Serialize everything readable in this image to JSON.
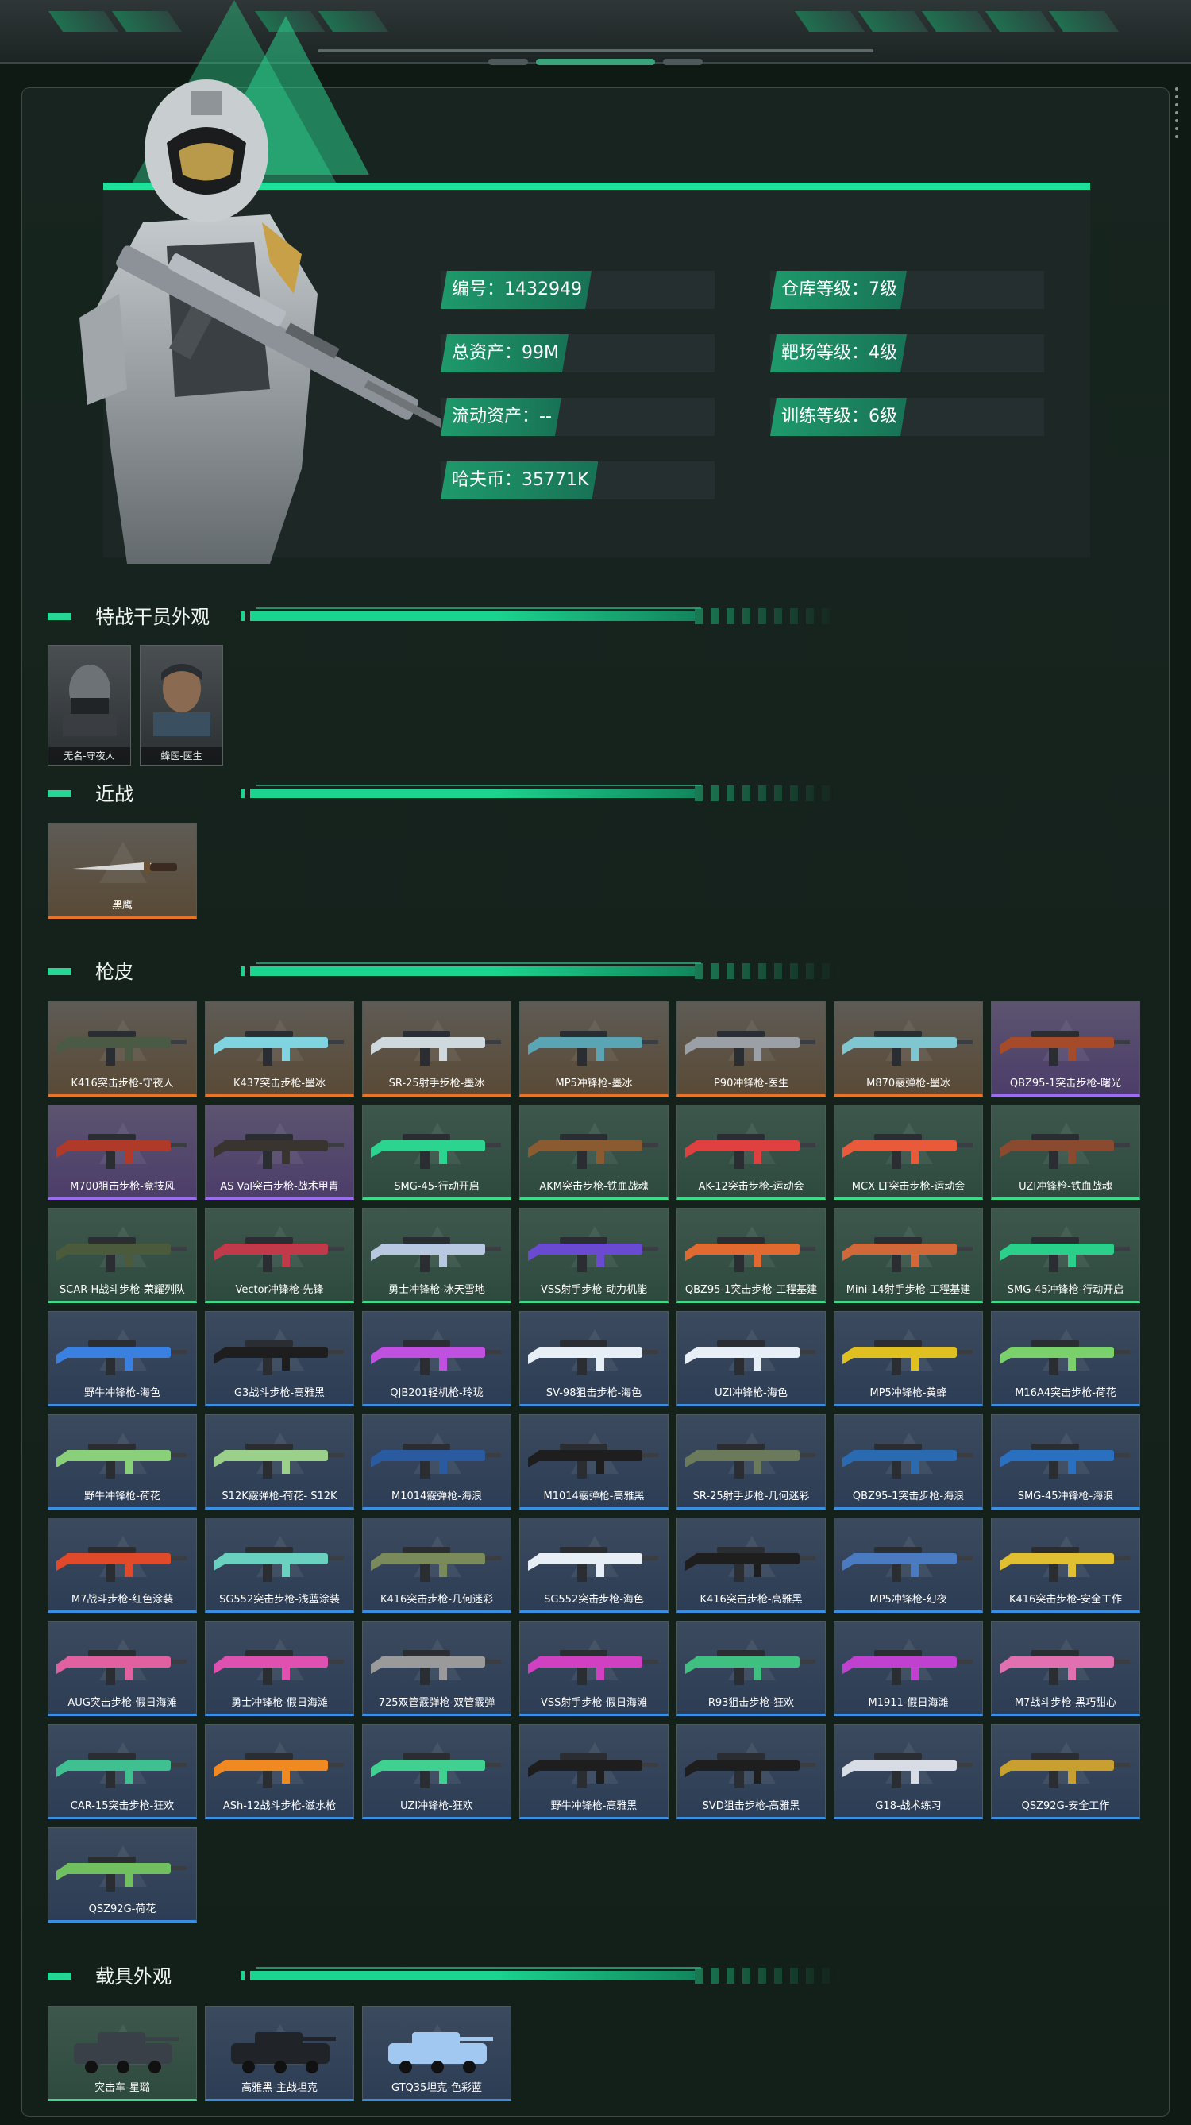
{
  "stats": {
    "id": {
      "label": "编号：",
      "value": "1432949"
    },
    "total_assets": {
      "label": "总资产：",
      "value": "99M"
    },
    "liquid_assets": {
      "label": "流动资产：",
      "value": "--"
    },
    "hafu_coin": {
      "label": "哈夫币：",
      "value": "35771K"
    },
    "warehouse_level": {
      "label": "仓库等级：",
      "value": "7级"
    },
    "range_level": {
      "label": "靶场等级：",
      "value": "4级"
    },
    "training_level": {
      "label": "训练等级：",
      "value": "6级"
    }
  },
  "sections": {
    "agents": "特战干员外观",
    "melee": "近战",
    "skins": "枪皮",
    "vehicles": "载具外观"
  },
  "agents": [
    {
      "label": "无名-守夜人"
    },
    {
      "label": "蜂医-医生"
    }
  ],
  "melee": [
    {
      "label": "黑鹰",
      "rarity": "orange"
    }
  ],
  "skins": [
    {
      "label": "K416突击步枪-守夜人",
      "rarity": "orange",
      "color": "#4a5a45"
    },
    {
      "label": "K437突击步枪-墨冰",
      "rarity": "orange",
      "color": "#7fd4e0"
    },
    {
      "label": "SR-25射手步枪-墨冰",
      "rarity": "orange",
      "color": "#cfd8dc"
    },
    {
      "label": "MP5冲锋枪-墨冰",
      "rarity": "orange",
      "color": "#5aa4b4"
    },
    {
      "label": "P90冲锋枪-医生",
      "rarity": "orange",
      "color": "#9aa0a6"
    },
    {
      "label": "M870霰弹枪-墨冰",
      "rarity": "orange",
      "color": "#7fc6d0"
    },
    {
      "label": "QBZ95-1突击步枪-曙光",
      "rarity": "purple",
      "color": "#a64b2a"
    },
    {
      "label": "M700狙击步枪-竞技风",
      "rarity": "purple",
      "color": "#b03a2a"
    },
    {
      "label": "AS Val突击步枪-战术甲胄",
      "rarity": "purple",
      "color": "#3a3430"
    },
    {
      "label": "SMG-45-行动开启",
      "rarity": "green",
      "color": "#2bd48f"
    },
    {
      "label": "AKM突击步枪-铁血战魂",
      "rarity": "green",
      "color": "#8a5a30"
    },
    {
      "label": "AK-12突击步枪-运动会",
      "rarity": "green",
      "color": "#e04040"
    },
    {
      "label": "MCX LT突击步枪-运动会",
      "rarity": "green",
      "color": "#e85a3a"
    },
    {
      "label": "UZI冲锋枪-铁血战魂",
      "rarity": "green",
      "color": "#8a4a30"
    },
    {
      "label": "SCAR-H战斗步枪-荣耀列队",
      "rarity": "green",
      "color": "#4a5a3a"
    },
    {
      "label": "Vector冲锋枪-先锋",
      "rarity": "green",
      "color": "#c03a4a"
    },
    {
      "label": "勇士冲锋枪-冰天雪地",
      "rarity": "green",
      "color": "#b8c8e0"
    },
    {
      "label": "VSS射手步枪-动力机能",
      "rarity": "green",
      "color": "#6a4ad0"
    },
    {
      "label": "QBZ95-1突击步枪-工程基建",
      "rarity": "green",
      "color": "#e06a30"
    },
    {
      "label": "Mini-14射手步枪-工程基建",
      "rarity": "green",
      "color": "#d0683a"
    },
    {
      "label": "SMG-45冲锋枪-行动开启",
      "rarity": "green",
      "color": "#2ad08a"
    },
    {
      "label": "野牛冲锋枪-海色",
      "rarity": "blue",
      "color": "#3a80e0"
    },
    {
      "label": "G3战斗步枪-高雅黑",
      "rarity": "blue",
      "color": "#1e1e1e"
    },
    {
      "label": "QJB201轻机枪-玲珑",
      "rarity": "blue",
      "color": "#c050e0"
    },
    {
      "label": "SV-98狙击步枪-海色",
      "rarity": "blue",
      "color": "#e8eef5"
    },
    {
      "label": "UZI冲锋枪-海色",
      "rarity": "blue",
      "color": "#e8eef5"
    },
    {
      "label": "MP5冲锋枪-黄蜂",
      "rarity": "blue",
      "color": "#e0c020"
    },
    {
      "label": "M16A4突击步枪-荷花",
      "rarity": "blue",
      "color": "#7ad06a"
    },
    {
      "label": "野牛冲锋枪-荷花",
      "rarity": "blue",
      "color": "#8ad07a"
    },
    {
      "label": "S12K霰弹枪-荷花- S12K",
      "rarity": "blue",
      "color": "#9ad08a"
    },
    {
      "label": "M1014霰弹枪-海浪",
      "rarity": "blue",
      "color": "#2a5aa0"
    },
    {
      "label": "M1014霰弹枪-高雅黑",
      "rarity": "blue",
      "color": "#1e1e1e"
    },
    {
      "label": "SR-25射手步枪-几何迷彩",
      "rarity": "blue",
      "color": "#6a7a5a"
    },
    {
      "label": "QBZ95-1突击步枪-海浪",
      "rarity": "blue",
      "color": "#2a6ab0"
    },
    {
      "label": "SMG-45冲锋枪-海浪",
      "rarity": "blue",
      "color": "#2a70c0"
    },
    {
      "label": "M7战斗步枪-红色涂装",
      "rarity": "blue",
      "color": "#e04a2a"
    },
    {
      "label": "SG552突击步枪-浅蓝涂装",
      "rarity": "blue",
      "color": "#6ad0c0"
    },
    {
      "label": "K416突击步枪-几何迷彩",
      "rarity": "blue",
      "color": "#7a8a5a"
    },
    {
      "label": "SG552突击步枪-海色",
      "rarity": "blue",
      "color": "#e8eef5"
    },
    {
      "label": "K416突击步枪-高雅黑",
      "rarity": "blue",
      "color": "#1e1e1e"
    },
    {
      "label": "MP5冲锋枪-幻夜",
      "rarity": "blue",
      "color": "#4a7ac0"
    },
    {
      "label": "K416突击步枪-安全工作",
      "rarity": "blue",
      "color": "#e0c030"
    },
    {
      "label": "AUG突击步枪-假日海滩",
      "rarity": "blue",
      "color": "#e060a0"
    },
    {
      "label": "勇士冲锋枪-假日海滩",
      "rarity": "blue",
      "color": "#e050b0"
    },
    {
      "label": "725双管霰弹枪-双管霰弹",
      "rarity": "blue",
      "color": "#9a9a9a"
    },
    {
      "label": "VSS射手步枪-假日海滩",
      "rarity": "blue",
      "color": "#d040c0"
    },
    {
      "label": "R93狙击步枪-狂欢",
      "rarity": "blue",
      "color": "#40c080"
    },
    {
      "label": "M1911-假日海滩",
      "rarity": "blue",
      "color": "#c040d0"
    },
    {
      "label": "M7战斗步枪-黑巧甜心",
      "rarity": "blue",
      "color": "#e070b0"
    },
    {
      "label": "CAR-15突击步枪-狂欢",
      "rarity": "blue",
      "color": "#40c090"
    },
    {
      "label": "ASh-12战斗步枪-滋水枪",
      "rarity": "blue",
      "color": "#f08a20"
    },
    {
      "label": "UZI冲锋枪-狂欢",
      "rarity": "blue",
      "color": "#40d090"
    },
    {
      "label": "野牛冲锋枪-高雅黑",
      "rarity": "blue",
      "color": "#1e1e1e"
    },
    {
      "label": "SVD狙击步枪-高雅黑",
      "rarity": "blue",
      "color": "#1e1e1e"
    },
    {
      "label": "G18-战术练习",
      "rarity": "blue",
      "color": "#d8dde5"
    },
    {
      "label": "QSZ92G-安全工作",
      "rarity": "blue",
      "color": "#c8a030"
    },
    {
      "label": "QSZ92G-荷花",
      "rarity": "blue",
      "color": "#70c060"
    }
  ],
  "vehicles": [
    {
      "label": "突击车-星璐",
      "rarity": "green",
      "color": "#3a4048"
    },
    {
      "label": "高雅黑-主战坦克",
      "rarity": "blue",
      "color": "#202428"
    },
    {
      "label": "GTQ35坦克-色彩蓝",
      "rarity": "blue",
      "color": "#a0c8f0"
    }
  ]
}
